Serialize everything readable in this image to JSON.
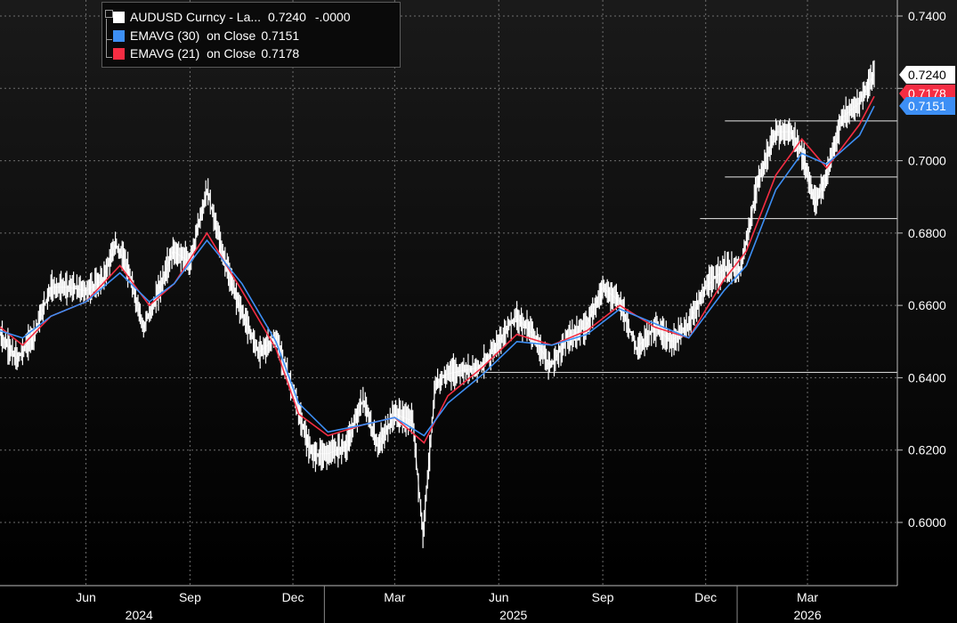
{
  "legend": {
    "items": [
      {
        "label": "AUDUSD Curncy - La...",
        "value": "0.7240",
        "change": "-.0000",
        "color": "#ffffff"
      },
      {
        "label": "EMAVG (30)  on Close",
        "value": "0.7151",
        "color": "#3d8ff5"
      },
      {
        "label": "EMAVG (21)  on Close",
        "value": "0.7178",
        "color": "#f52d43"
      }
    ]
  },
  "value_tags": [
    {
      "text": "0.7240",
      "bg": "#ffffff",
      "fg": "#000000"
    },
    {
      "text": "0.7178",
      "bg": "#f52d43",
      "fg": "#ffffff"
    },
    {
      "text": "0.7151",
      "bg": "#3d8ff5",
      "fg": "#ffffff"
    }
  ],
  "chart_data": {
    "type": "line",
    "ylim": [
      0.59,
      0.741
    ],
    "y_ticks": [
      "0.6000",
      "0.6200",
      "0.6400",
      "0.6600",
      "0.6800",
      "0.7000",
      "0.7200",
      "0.7400"
    ],
    "x_months": [
      "Jun",
      "Sep",
      "Dec",
      "Mar",
      "Jun",
      "Sep",
      "Dec",
      "Mar"
    ],
    "x_years": [
      "2024",
      "2025",
      "2026"
    ],
    "grid": true,
    "legend_position": "top-left",
    "price_series": {
      "name": "AUDUSD Curncy",
      "color": "#ffffff",
      "points": [
        [
          "2024-03-31",
          0.652
        ],
        [
          "2024-04-15",
          0.645
        ],
        [
          "2024-04-30",
          0.652
        ],
        [
          "2024-05-15",
          0.665
        ],
        [
          "2024-05-31",
          0.665
        ],
        [
          "2024-06-15",
          0.664
        ],
        [
          "2024-06-30",
          0.667
        ],
        [
          "2024-07-11",
          0.677
        ],
        [
          "2024-07-20",
          0.672
        ],
        [
          "2024-08-05",
          0.654
        ],
        [
          "2024-08-15",
          0.661
        ],
        [
          "2024-08-31",
          0.675
        ],
        [
          "2024-09-15",
          0.672
        ],
        [
          "2024-09-30",
          0.692
        ],
        [
          "2024-10-15",
          0.673
        ],
        [
          "2024-10-31",
          0.658
        ],
        [
          "2024-11-15",
          0.647
        ],
        [
          "2024-11-30",
          0.651
        ],
        [
          "2024-12-15",
          0.636
        ],
        [
          "2024-12-31",
          0.619
        ],
        [
          "2025-01-15",
          0.619
        ],
        [
          "2025-01-31",
          0.621
        ],
        [
          "2025-02-15",
          0.634
        ],
        [
          "2025-02-28",
          0.621
        ],
        [
          "2025-03-15",
          0.63
        ],
        [
          "2025-03-31",
          0.628
        ],
        [
          "2025-04-09",
          0.597
        ],
        [
          "2025-04-20",
          0.638
        ],
        [
          "2025-04-30",
          0.641
        ],
        [
          "2025-05-15",
          0.642
        ],
        [
          "2025-05-31",
          0.643
        ],
        [
          "2025-06-15",
          0.65
        ],
        [
          "2025-06-30",
          0.657
        ],
        [
          "2025-07-15",
          0.652
        ],
        [
          "2025-07-31",
          0.643
        ],
        [
          "2025-08-15",
          0.651
        ],
        [
          "2025-08-31",
          0.654
        ],
        [
          "2025-09-15",
          0.665
        ],
        [
          "2025-09-30",
          0.661
        ],
        [
          "2025-10-15",
          0.648
        ],
        [
          "2025-10-31",
          0.654
        ],
        [
          "2025-11-15",
          0.65
        ],
        [
          "2025-11-30",
          0.655
        ],
        [
          "2025-12-15",
          0.665
        ],
        [
          "2025-12-31",
          0.67
        ],
        [
          "2026-01-15",
          0.67
        ],
        [
          "2026-01-31",
          0.695
        ],
        [
          "2026-02-15",
          0.708
        ],
        [
          "2026-02-28",
          0.708
        ],
        [
          "2026-03-10",
          0.702
        ],
        [
          "2026-03-22",
          0.688
        ],
        [
          "2026-03-31",
          0.695
        ],
        [
          "2026-04-15",
          0.712
        ],
        [
          "2026-04-30",
          0.716
        ],
        [
          "2026-05-13",
          0.724
        ]
      ]
    },
    "series": [
      {
        "name": "EMAVG (21)",
        "color": "#f52d43",
        "points": [
          [
            "2024-03-31",
            0.654
          ],
          [
            "2024-04-20",
            0.649
          ],
          [
            "2024-05-15",
            0.657
          ],
          [
            "2024-06-15",
            0.661
          ],
          [
            "2024-07-15",
            0.671
          ],
          [
            "2024-08-10",
            0.66
          ],
          [
            "2024-09-01",
            0.666
          ],
          [
            "2024-09-30",
            0.68
          ],
          [
            "2024-10-31",
            0.664
          ],
          [
            "2024-11-30",
            0.648
          ],
          [
            "2024-12-20",
            0.63
          ],
          [
            "2025-01-15",
            0.624
          ],
          [
            "2025-02-15",
            0.627
          ],
          [
            "2025-03-15",
            0.629
          ],
          [
            "2025-04-10",
            0.622
          ],
          [
            "2025-05-01",
            0.635
          ],
          [
            "2025-06-01",
            0.643
          ],
          [
            "2025-07-01",
            0.652
          ],
          [
            "2025-08-01",
            0.649
          ],
          [
            "2025-09-01",
            0.653
          ],
          [
            "2025-09-30",
            0.66
          ],
          [
            "2025-10-31",
            0.654
          ],
          [
            "2025-11-30",
            0.651
          ],
          [
            "2025-12-31",
            0.667
          ],
          [
            "2026-01-20",
            0.675
          ],
          [
            "2026-02-15",
            0.696
          ],
          [
            "2026-03-10",
            0.706
          ],
          [
            "2026-04-01",
            0.698
          ],
          [
            "2026-04-30",
            0.71
          ],
          [
            "2026-05-13",
            0.7178
          ]
        ]
      },
      {
        "name": "EMAVG (30)",
        "color": "#3d8ff5",
        "points": [
          [
            "2024-03-31",
            0.653
          ],
          [
            "2024-04-20",
            0.651
          ],
          [
            "2024-05-15",
            0.657
          ],
          [
            "2024-06-15",
            0.661
          ],
          [
            "2024-07-15",
            0.669
          ],
          [
            "2024-08-10",
            0.661
          ],
          [
            "2024-09-01",
            0.666
          ],
          [
            "2024-09-30",
            0.678
          ],
          [
            "2024-10-31",
            0.666
          ],
          [
            "2024-11-30",
            0.65
          ],
          [
            "2024-12-20",
            0.633
          ],
          [
            "2025-01-15",
            0.625
          ],
          [
            "2025-02-15",
            0.627
          ],
          [
            "2025-03-15",
            0.629
          ],
          [
            "2025-04-10",
            0.624
          ],
          [
            "2025-05-01",
            0.633
          ],
          [
            "2025-06-01",
            0.641
          ],
          [
            "2025-07-01",
            0.65
          ],
          [
            "2025-08-01",
            0.649
          ],
          [
            "2025-09-01",
            0.652
          ],
          [
            "2025-09-30",
            0.659
          ],
          [
            "2025-10-31",
            0.655
          ],
          [
            "2025-11-30",
            0.651
          ],
          [
            "2025-12-31",
            0.664
          ],
          [
            "2026-01-20",
            0.671
          ],
          [
            "2026-02-15",
            0.692
          ],
          [
            "2026-03-10",
            0.702
          ],
          [
            "2026-04-01",
            0.699
          ],
          [
            "2026-04-30",
            0.707
          ],
          [
            "2026-05-13",
            0.7151
          ]
        ]
      }
    ],
    "reference_lines": [
      {
        "y": 0.711,
        "x_start": "2026-01-01"
      },
      {
        "y": 0.6955,
        "x_start": "2026-01-01"
      },
      {
        "y": 0.684,
        "x_start": "2025-12-10"
      },
      {
        "y": 0.6415,
        "x_start": "2025-06-01"
      }
    ]
  }
}
